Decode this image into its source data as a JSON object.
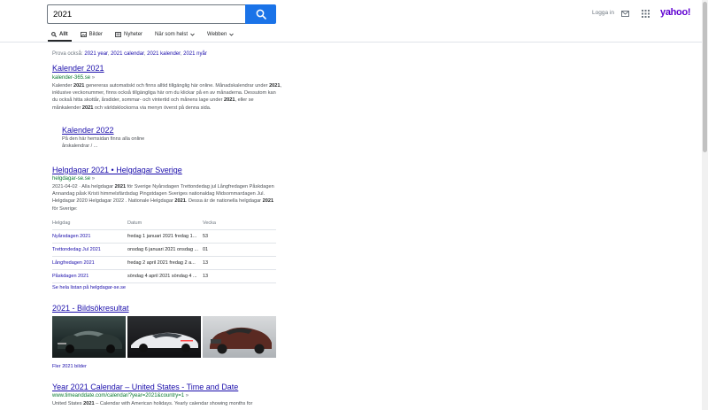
{
  "search": {
    "query": "2021"
  },
  "header": {
    "login": "Logga in",
    "logo": "yahoo!"
  },
  "tabs": [
    {
      "label": "Allt",
      "icon": "search-icon"
    },
    {
      "label": "Bilder",
      "icon": "image-icon"
    },
    {
      "label": "Nyheter",
      "icon": "news-icon"
    },
    {
      "label": "När som helst",
      "icon": "chevron-down-icon"
    },
    {
      "label": "Webben",
      "icon": "chevron-down-icon"
    }
  ],
  "also": {
    "prefix": "Prova också:",
    "links": [
      "2021 year",
      "2021 calendar",
      "2021 kalender",
      "2021 nyår"
    ]
  },
  "results": {
    "r1": {
      "title": "Kalender 2021",
      "url": "kalender-365.se",
      "snippet": [
        "Kalender ",
        "2021",
        " genereras automatiskt och finns alltid tillgänglig här online. Månadskalendrar under ",
        "2021",
        ", inklusive veckonummer, finns också tillgängliga här om du klickar på en av månaderna. Dessutom kan du också hitta skottår, årsdider, sommar- och vintertid och månens lage under ",
        "2021",
        ", eller se månkalender ",
        "2021",
        " och världsklockorna via menyn överst på denna sida."
      ],
      "sub_title": "Kalender 2022",
      "sub_snippet": "På den här hemsidan finns alla online årskalendrar / ..."
    },
    "r2": {
      "title": "Helgdagar 2021 • Helgdagar Sverige",
      "url": "helgdagar-se.se",
      "snippet": [
        "2021",
        "-04-02 · Alla helgdagar ",
        "2021",
        " för Sverige Nyårsdagen Trettondedag jul Långfredagen Påskdagen Annandag påsk Kristi himmelsfärdsdag Pingstdagen Sveriges nationaldag Midsommardagen Jul. Helgdagar 2020 Helgdagar 2022 . Nationale Helgdagar ",
        "2021",
        ". Dessa är de nationella helgdagar ",
        "2021",
        " för Sverige:"
      ],
      "table": {
        "headers": [
          "Helgdag",
          "Datum",
          "Vecka"
        ],
        "rows": [
          [
            "Nyårsdagen 2021",
            "fredag 1 januari 2021 fredag 1...",
            "53"
          ],
          [
            "Trettondedag Jul 2021",
            "onsdag 6 januari 2021 onsdag ...",
            "01"
          ],
          [
            "Långfredagen 2021",
            "fredag 2 april 2021 fredag 2 a...",
            "13"
          ],
          [
            "Påskdagen 2021",
            "söndag 4 april 2021 söndag 4 ...",
            "13"
          ]
        ]
      },
      "more": "Se hela listan på helgdagar-se.se"
    },
    "images": {
      "title": "2021 - Bildsökresultat",
      "more": "Fler 2021 bilder"
    },
    "r3": {
      "title": "Year 2021 Calendar – United States - Time and Date",
      "url": "www.timeanddate.com/calendar/?year=2021&country=1",
      "snippet": [
        "United States ",
        "2021",
        " – Calendar with American holidays. Yearly calendar showing months for"
      ]
    }
  }
}
